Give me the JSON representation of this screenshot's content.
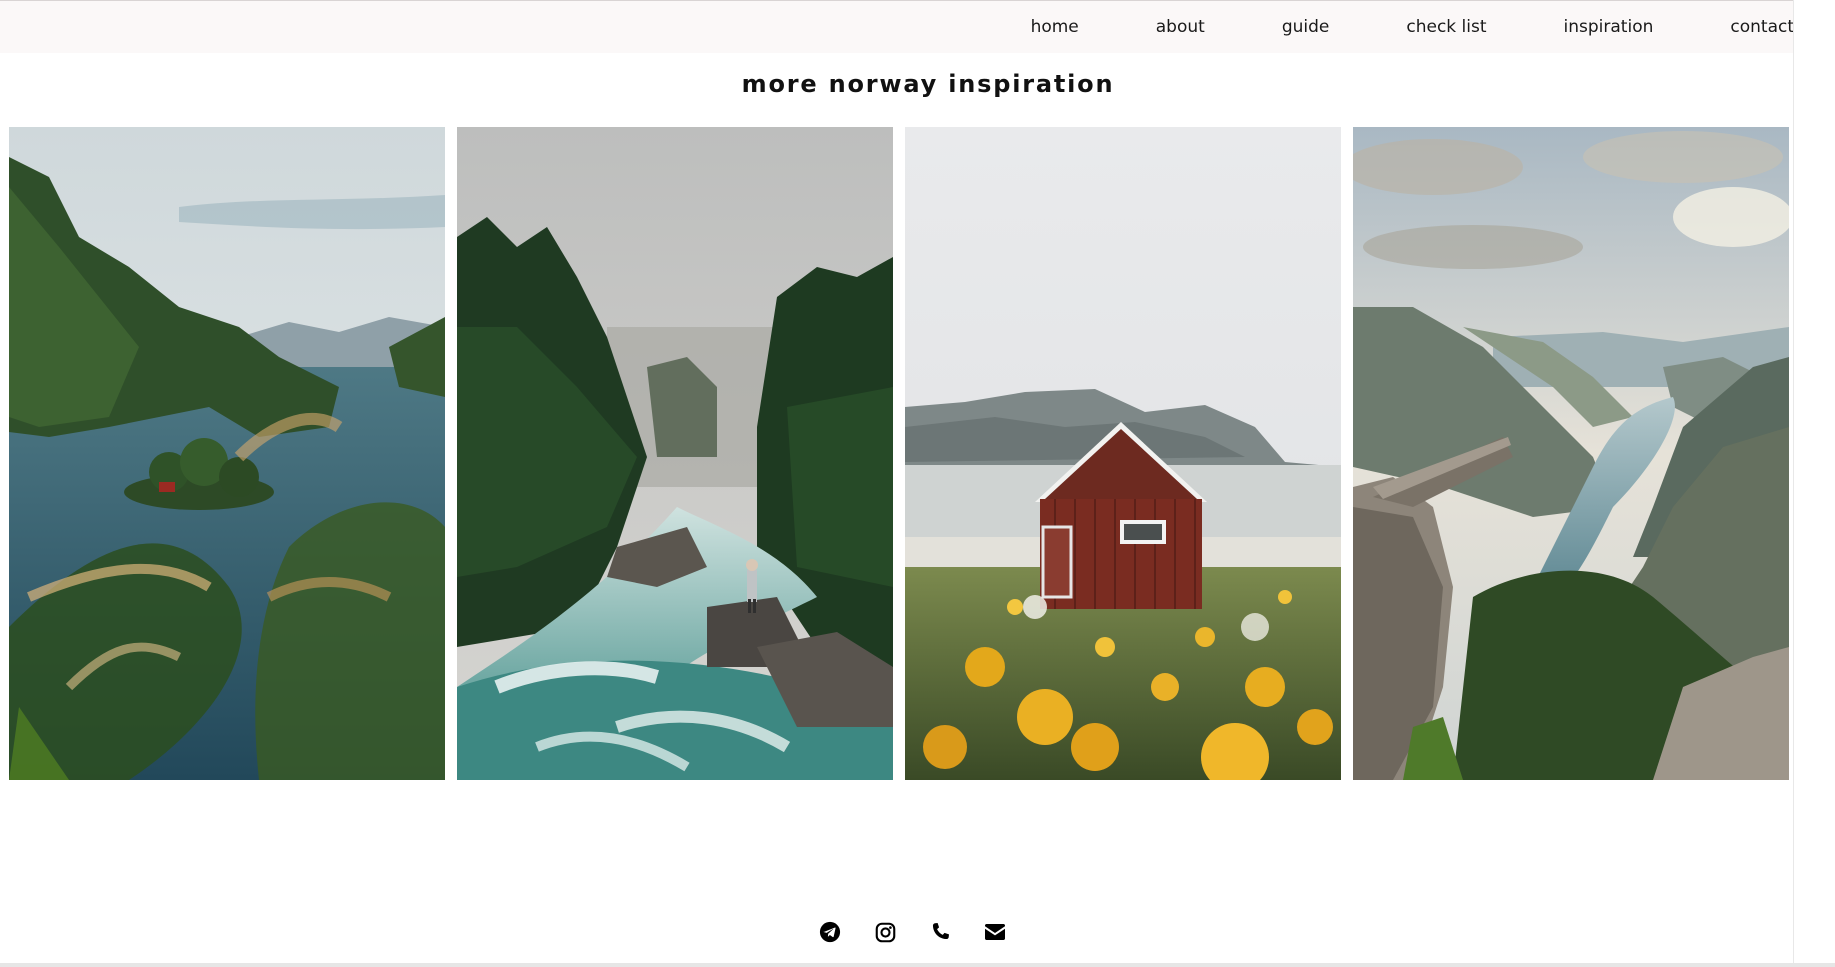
{
  "nav": {
    "items": [
      {
        "label": "home"
      },
      {
        "label": "about"
      },
      {
        "label": "guide"
      },
      {
        "label": "check list"
      },
      {
        "label": "inspiration"
      },
      {
        "label": "contact"
      }
    ]
  },
  "main": {
    "title": "more norway inspiration"
  },
  "gallery": {
    "photos": [
      {
        "subject": "fjord-with-island"
      },
      {
        "subject": "forest-waterfall-hiker"
      },
      {
        "subject": "red-cabin-yellow-flowers"
      },
      {
        "subject": "trolltunga-cliff-fjord"
      }
    ]
  },
  "footer": {
    "icons": [
      "telegram-icon",
      "instagram-icon",
      "phone-icon",
      "email-icon"
    ]
  },
  "colors": {
    "nav_background": "#fbf8f8",
    "text": "#1a1a1a",
    "icon": "#000000"
  }
}
